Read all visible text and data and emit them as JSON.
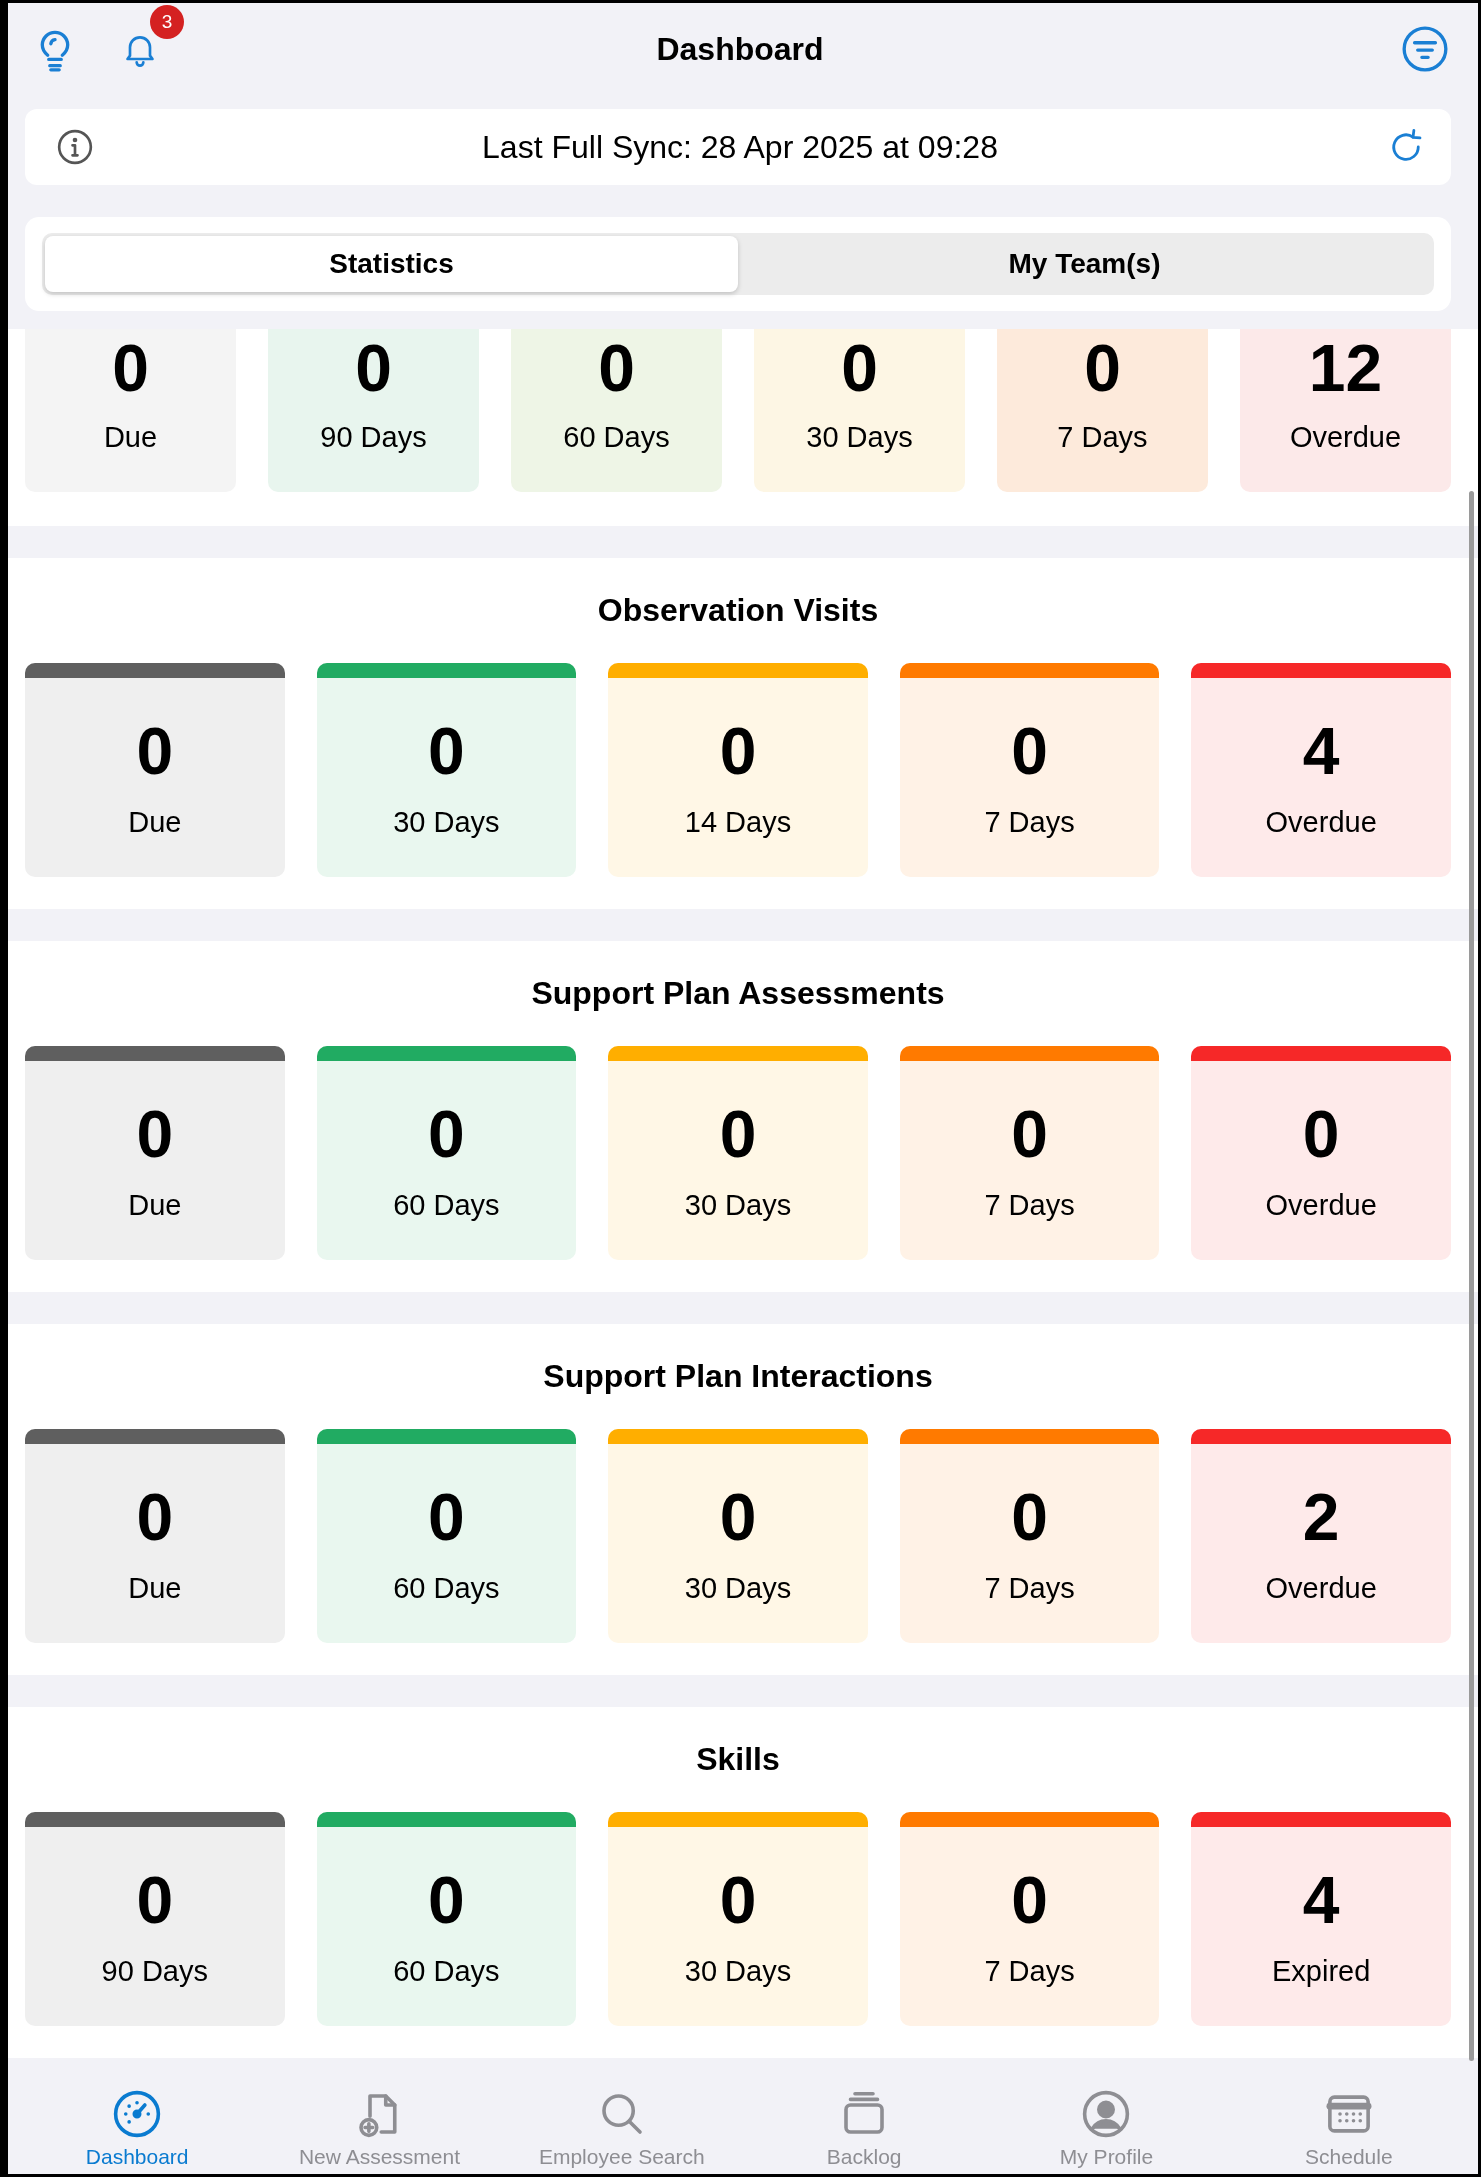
{
  "header": {
    "title": "Dashboard",
    "notification_count": "3"
  },
  "sync": {
    "text": "Last Full Sync: 28 Apr 2025 at 09:28"
  },
  "segments": [
    {
      "label": "Statistics",
      "selected": true
    },
    {
      "label": "My Team(s)",
      "selected": false
    }
  ],
  "summary_cards": [
    {
      "value": "0",
      "label": "Due",
      "color": "#f4f4f4"
    },
    {
      "value": "0",
      "label": "90 Days",
      "color": "#e8f5ee"
    },
    {
      "value": "0",
      "label": "60 Days",
      "color": "#eef5e6"
    },
    {
      "value": "0",
      "label": "30 Days",
      "color": "#fdf6e4"
    },
    {
      "value": "0",
      "label": "7 Days",
      "color": "#fdeadb"
    },
    {
      "value": "12",
      "label": "Overdue",
      "color": "#fce9e9"
    }
  ],
  "sections": [
    {
      "title": "Observation Visits",
      "cards": [
        {
          "value": "0",
          "label": "Due",
          "color": "#5f5f5f"
        },
        {
          "value": "0",
          "label": "30 Days",
          "color": "#21ab62"
        },
        {
          "value": "0",
          "label": "14 Days",
          "color": "#ffae00"
        },
        {
          "value": "0",
          "label": "7 Days",
          "color": "#ff7a00"
        },
        {
          "value": "4",
          "label": "Overdue",
          "color": "#f62828"
        }
      ]
    },
    {
      "title": "Support Plan Assessments",
      "cards": [
        {
          "value": "0",
          "label": "Due",
          "color": "#5f5f5f"
        },
        {
          "value": "0",
          "label": "60 Days",
          "color": "#21ab62"
        },
        {
          "value": "0",
          "label": "30 Days",
          "color": "#ffae00"
        },
        {
          "value": "0",
          "label": "7 Days",
          "color": "#ff7a00"
        },
        {
          "value": "0",
          "label": "Overdue",
          "color": "#f62828"
        }
      ]
    },
    {
      "title": "Support Plan Interactions",
      "cards": [
        {
          "value": "0",
          "label": "Due",
          "color": "#5f5f5f"
        },
        {
          "value": "0",
          "label": "60 Days",
          "color": "#21ab62"
        },
        {
          "value": "0",
          "label": "30 Days",
          "color": "#ffae00"
        },
        {
          "value": "0",
          "label": "7 Days",
          "color": "#ff7a00"
        },
        {
          "value": "2",
          "label": "Overdue",
          "color": "#f62828"
        }
      ]
    },
    {
      "title": "Skills",
      "cards": [
        {
          "value": "0",
          "label": "90 Days",
          "color": "#5f5f5f"
        },
        {
          "value": "0",
          "label": "60 Days",
          "color": "#21ab62"
        },
        {
          "value": "0",
          "label": "30 Days",
          "color": "#ffae00"
        },
        {
          "value": "0",
          "label": "7 Days",
          "color": "#ff7a00"
        },
        {
          "value": "4",
          "label": "Expired",
          "color": "#f62828"
        }
      ]
    }
  ],
  "tab_bar": [
    {
      "label": "Dashboard",
      "selected": true
    },
    {
      "label": "New Assessment",
      "selected": false
    },
    {
      "label": "Employee Search",
      "selected": false
    },
    {
      "label": "Backlog",
      "selected": false
    },
    {
      "label": "My Profile",
      "selected": false
    },
    {
      "label": "Schedule",
      "selected": false
    }
  ]
}
